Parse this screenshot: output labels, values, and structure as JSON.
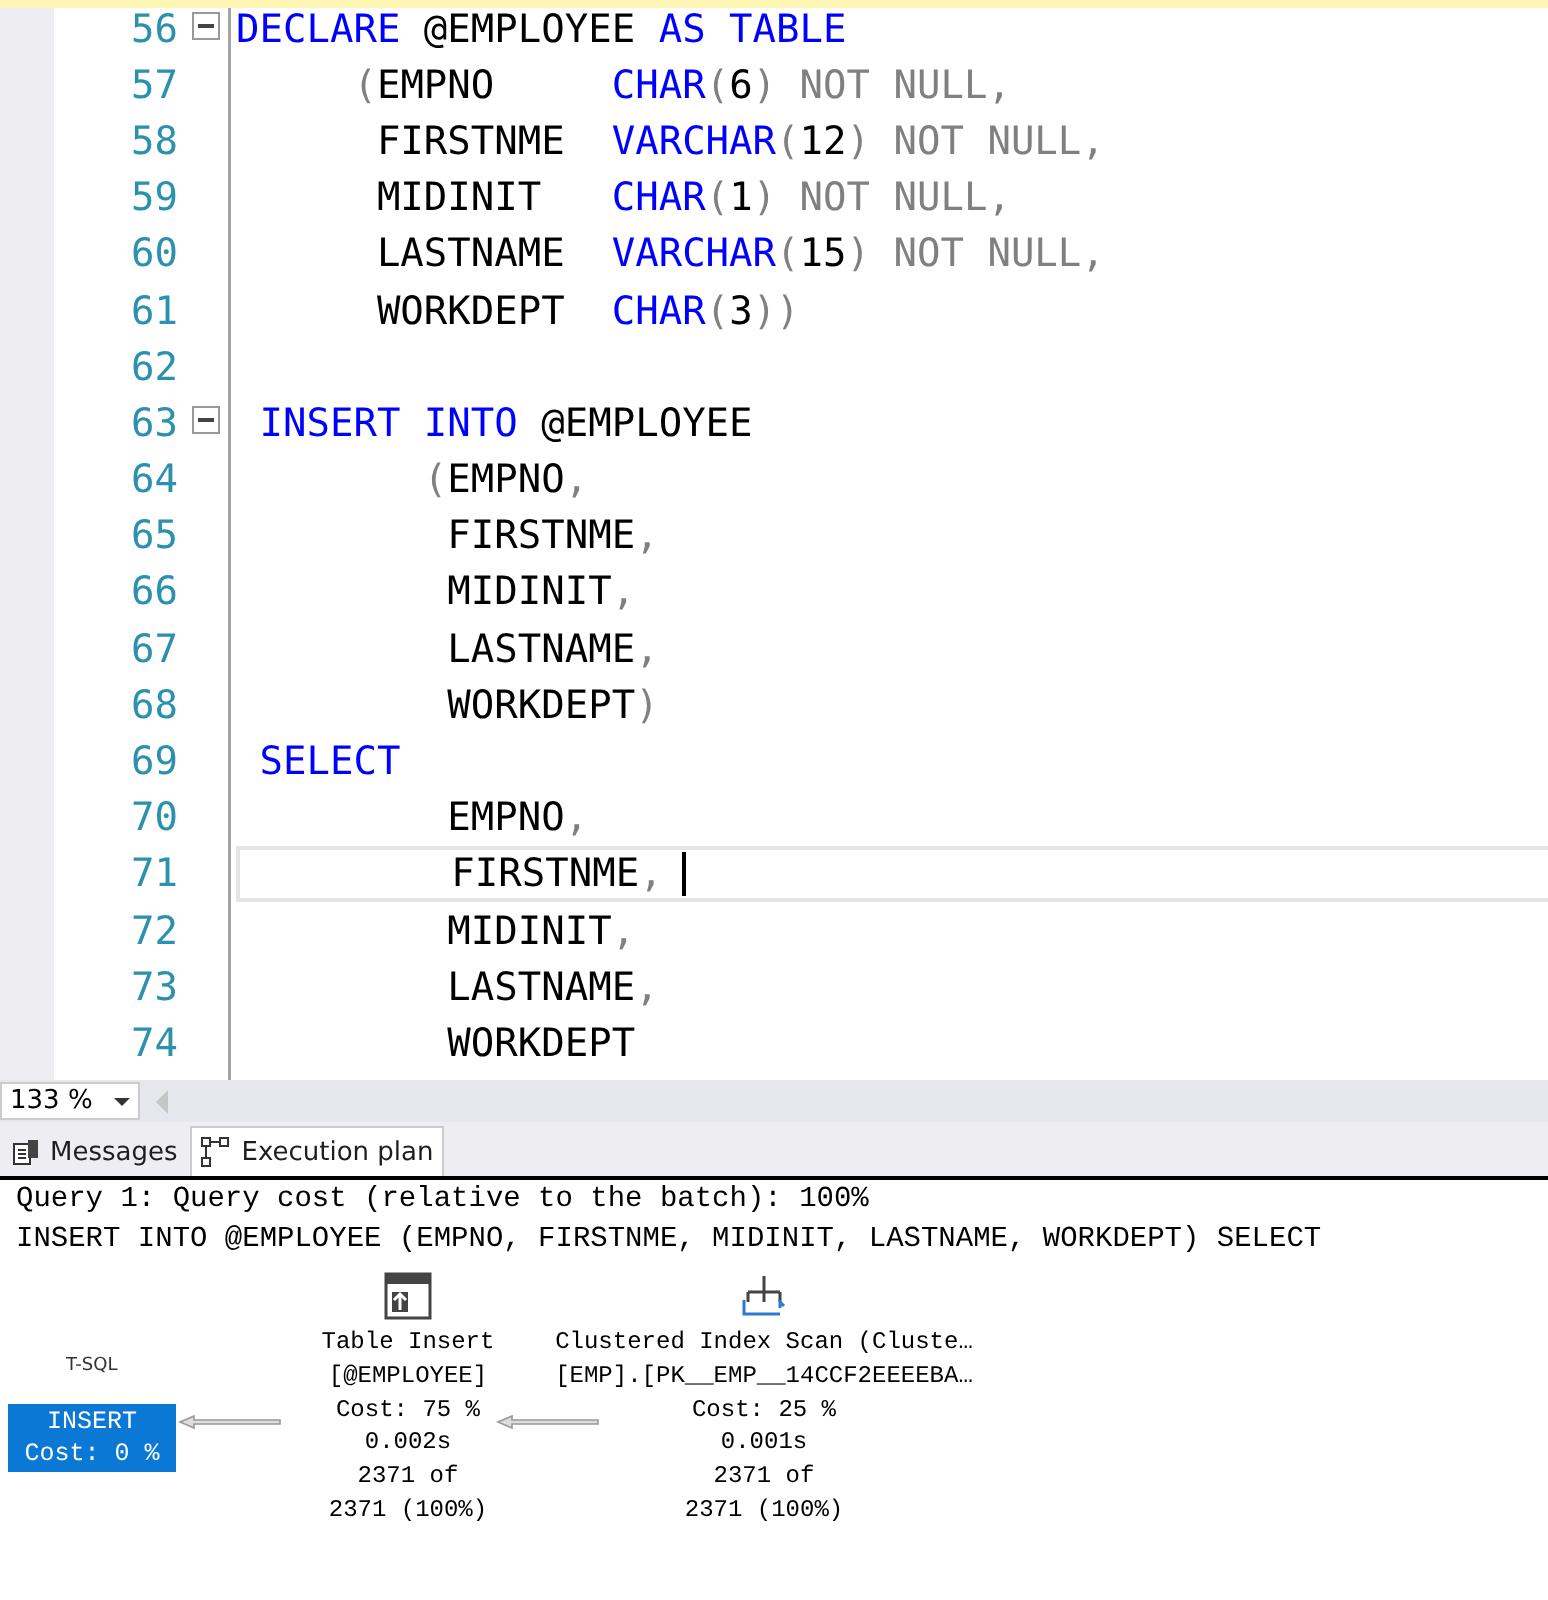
{
  "editor": {
    "lines": [
      {
        "number": "56",
        "fold": true,
        "current": false,
        "tokens": [
          {
            "kind": "kw",
            "text": "DECLARE"
          },
          {
            "kind": "id",
            "text": " @EMPLOYEE "
          },
          {
            "kind": "kw",
            "text": "AS TABLE"
          }
        ]
      },
      {
        "number": "57",
        "fold": false,
        "current": false,
        "tokens": [
          {
            "kind": "op",
            "text": "     ("
          },
          {
            "kind": "id",
            "text": "EMPNO     "
          },
          {
            "kind": "kw",
            "text": "CHAR"
          },
          {
            "kind": "op",
            "text": "("
          },
          {
            "kind": "id",
            "text": "6"
          },
          {
            "kind": "op",
            "text": ") NOT NULL,"
          }
        ]
      },
      {
        "number": "58",
        "fold": false,
        "current": false,
        "tokens": [
          {
            "kind": "id",
            "text": "      FIRSTNME  "
          },
          {
            "kind": "kw",
            "text": "VARCHAR"
          },
          {
            "kind": "op",
            "text": "("
          },
          {
            "kind": "id",
            "text": "12"
          },
          {
            "kind": "op",
            "text": ") NOT NULL,"
          }
        ]
      },
      {
        "number": "59",
        "fold": false,
        "current": false,
        "tokens": [
          {
            "kind": "id",
            "text": "      MIDINIT   "
          },
          {
            "kind": "kw",
            "text": "CHAR"
          },
          {
            "kind": "op",
            "text": "("
          },
          {
            "kind": "id",
            "text": "1"
          },
          {
            "kind": "op",
            "text": ") NOT NULL,"
          }
        ]
      },
      {
        "number": "60",
        "fold": false,
        "current": false,
        "tokens": [
          {
            "kind": "id",
            "text": "      LASTNAME  "
          },
          {
            "kind": "kw",
            "text": "VARCHAR"
          },
          {
            "kind": "op",
            "text": "("
          },
          {
            "kind": "id",
            "text": "15"
          },
          {
            "kind": "op",
            "text": ") NOT NULL,"
          }
        ]
      },
      {
        "number": "61",
        "fold": false,
        "current": false,
        "tokens": [
          {
            "kind": "id",
            "text": "      WORKDEPT  "
          },
          {
            "kind": "kw",
            "text": "CHAR"
          },
          {
            "kind": "op",
            "text": "("
          },
          {
            "kind": "id",
            "text": "3"
          },
          {
            "kind": "op",
            "text": "))"
          }
        ]
      },
      {
        "number": "62",
        "fold": false,
        "current": false
      },
      {
        "number": "63",
        "fold": true,
        "current": false,
        "tokens": [
          {
            "kind": "kw",
            "text": " INSERT INTO"
          },
          {
            "kind": "id",
            "text": " @EMPLOYEE"
          }
        ]
      },
      {
        "number": "64",
        "fold": false,
        "current": false,
        "tokens": [
          {
            "kind": "op",
            "text": "        ("
          },
          {
            "kind": "id",
            "text": "EMPNO"
          },
          {
            "kind": "op",
            "text": ","
          }
        ]
      },
      {
        "number": "65",
        "fold": false,
        "current": false,
        "tokens": [
          {
            "kind": "id",
            "text": "         FIRSTNME"
          },
          {
            "kind": "op",
            "text": ","
          }
        ]
      },
      {
        "number": "66",
        "fold": false,
        "current": false,
        "tokens": [
          {
            "kind": "id",
            "text": "         MIDINIT"
          },
          {
            "kind": "op",
            "text": ","
          }
        ]
      },
      {
        "number": "67",
        "fold": false,
        "current": false,
        "tokens": [
          {
            "kind": "id",
            "text": "         LASTNAME"
          },
          {
            "kind": "op",
            "text": ","
          }
        ]
      },
      {
        "number": "68",
        "fold": false,
        "current": false,
        "tokens": [
          {
            "kind": "id",
            "text": "         WORKDEPT"
          },
          {
            "kind": "op",
            "text": ")"
          }
        ]
      },
      {
        "number": "69",
        "fold": false,
        "current": false,
        "tokens": [
          {
            "kind": "kw",
            "text": " SELECT"
          }
        ]
      },
      {
        "number": "70",
        "fold": false,
        "current": false,
        "tokens": [
          {
            "kind": "id",
            "text": "         EMPNO"
          },
          {
            "kind": "op",
            "text": ","
          }
        ]
      },
      {
        "number": "71",
        "fold": false,
        "current": true,
        "tokens": [
          {
            "kind": "id",
            "text": "         FIRSTNME"
          },
          {
            "kind": "op",
            "text": ","
          }
        ]
      },
      {
        "number": "72",
        "fold": false,
        "current": false,
        "tokens": [
          {
            "kind": "id",
            "text": "         MIDINIT"
          },
          {
            "kind": "op",
            "text": ","
          }
        ]
      },
      {
        "number": "73",
        "fold": false,
        "current": false,
        "tokens": [
          {
            "kind": "id",
            "text": "         LASTNAME"
          },
          {
            "kind": "op",
            "text": ","
          }
        ]
      },
      {
        "number": "74",
        "fold": false,
        "current": false,
        "tokens": [
          {
            "kind": "id",
            "text": "         WORKDEPT"
          }
        ]
      }
    ]
  },
  "zoom": {
    "value": "133 %"
  },
  "tabs": [
    {
      "label": "Messages",
      "kind": "messages",
      "selected": false
    },
    {
      "label": "Execution plan",
      "kind": "plan",
      "selected": true
    }
  ],
  "plan": {
    "header": [
      "Query 1: Query cost (relative to the batch): 100%",
      "INSERT INTO @EMPLOYEE (EMPNO, FIRSTNME, MIDINIT, LASTNAME, WORKDEPT) SELECT"
    ],
    "root": {
      "label": "T-SQL",
      "lines": [
        "INSERT",
        "Cost: 0 %"
      ],
      "selected": true
    },
    "nodes": [
      {
        "kind": "insert",
        "selected": false,
        "lines": [
          "Table Insert",
          "[@EMPLOYEE]",
          "Cost: 75 %",
          "0.002s",
          "2371 of",
          "2371 (100%)"
        ]
      },
      {
        "kind": "scan",
        "selected": false,
        "lines": [
          "Clustered Index Scan (Cluste…",
          "[EMP].[PK__EMP__14CCF2EEEEBA…",
          "Cost: 25 %",
          "0.001s",
          "2371 of",
          "2371 (100%)"
        ]
      }
    ]
  }
}
